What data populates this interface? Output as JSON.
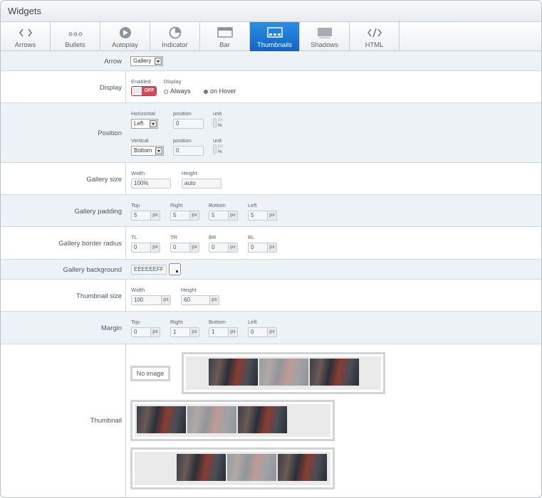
{
  "header": {
    "title": "Widgets"
  },
  "tabs": [
    {
      "label": "Arrows",
      "icon": "chevron-code-icon"
    },
    {
      "label": "Bullets",
      "icon": "dots-icon"
    },
    {
      "label": "Autoplay",
      "icon": "play-circle-icon"
    },
    {
      "label": "Indicator",
      "icon": "pie-indicator-icon"
    },
    {
      "label": "Bar",
      "icon": "bar-icon"
    },
    {
      "label": "Thumbnails",
      "icon": "thumbnails-icon",
      "active": true
    },
    {
      "label": "Shadows",
      "icon": "shadow-icon"
    },
    {
      "label": "HTML",
      "icon": "code-icon"
    }
  ],
  "arrow": {
    "label": "Arrow",
    "value": "Gallery"
  },
  "display": {
    "label": "Display",
    "enabled_caption": "Enabled",
    "display_caption": "Display",
    "toggle_text": "OFF",
    "option_always": "Always",
    "option_hover": "on Hover"
  },
  "position": {
    "label": "Position",
    "horizontal_caption": "Horizontal",
    "horizontal_value": "Left",
    "vertical_caption": "Vertical",
    "vertical_value": "Bottom",
    "position_caption": "position",
    "unit_caption": "unit",
    "horizontal_position": "0",
    "vertical_position": "0",
    "unit_px": "px",
    "unit_pct": "%"
  },
  "gallery_size": {
    "label": "Gallery size",
    "width_caption": "Width",
    "height_caption": "Height",
    "width": "100%",
    "height": "auto"
  },
  "gallery_padding": {
    "label": "Gallery padding",
    "top_caption": "Top",
    "right_caption": "Right",
    "bottom_caption": "Bottom",
    "left_caption": "Left",
    "top": "5",
    "right": "5",
    "bottom": "5",
    "left": "5",
    "unit": "px"
  },
  "gallery_border_radius": {
    "label": "Gallery border radius",
    "tl_caption": "TL",
    "tr_caption": "TR",
    "br_caption": "BR",
    "bl_caption": "BL",
    "tl": "0",
    "tr": "0",
    "br": "0",
    "bl": "0",
    "unit": "px"
  },
  "gallery_background": {
    "label": "Gallery background",
    "value": "EEEEEEFF"
  },
  "thumbnail_size": {
    "label": "Thumbnail size",
    "width_caption": "Width",
    "height_caption": "Height",
    "width": "100",
    "height": "60",
    "unit": "px"
  },
  "margin": {
    "label": "Margin",
    "top_caption": "Top",
    "right_caption": "Right",
    "bottom_caption": "Bottom",
    "left_caption": "Left",
    "top": "0",
    "right": "1",
    "bottom": "1",
    "left": "0",
    "unit": "px"
  },
  "thumbnail": {
    "label": "Thumbnail",
    "no_image": "No image"
  },
  "colors": {
    "accent": "#1a73d6",
    "toggle_off": "#d8475a",
    "row_alt": "#edf2f7"
  }
}
